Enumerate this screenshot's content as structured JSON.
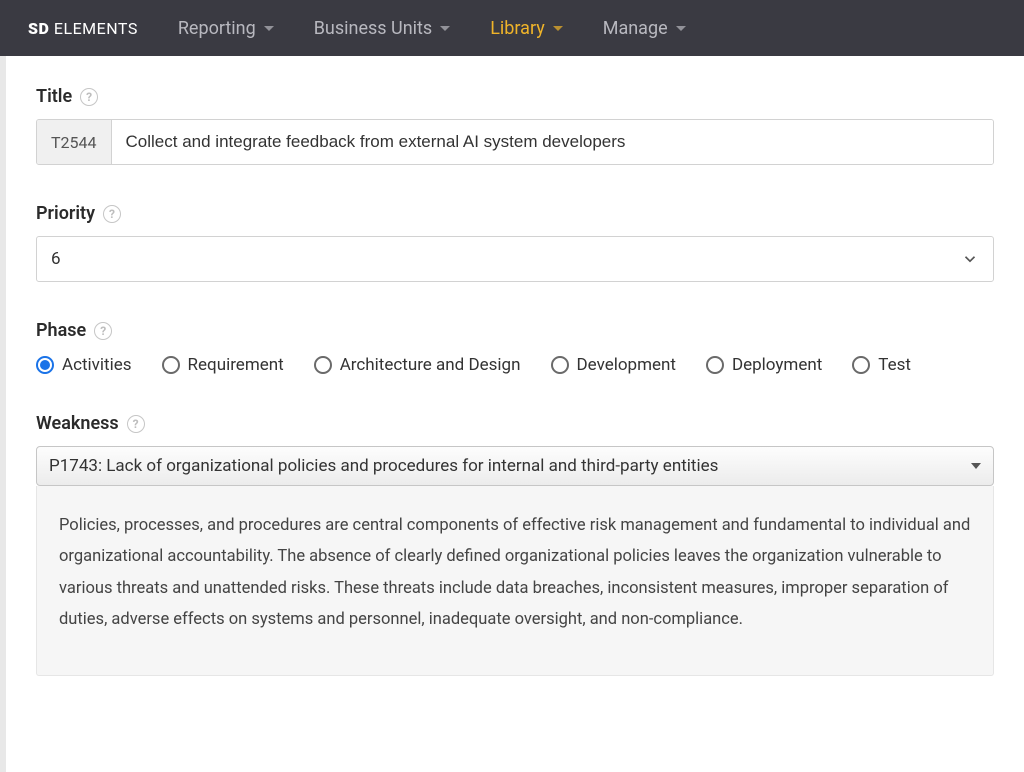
{
  "brand": {
    "left": "SD",
    "right": "ELEMENTS"
  },
  "nav": {
    "items": [
      {
        "label": "Reporting",
        "active": false
      },
      {
        "label": "Business Units",
        "active": false
      },
      {
        "label": "Library",
        "active": true
      },
      {
        "label": "Manage",
        "active": false
      }
    ]
  },
  "form": {
    "title": {
      "label": "Title",
      "id": "T2544",
      "value": "Collect and integrate feedback from external AI system developers"
    },
    "priority": {
      "label": "Priority",
      "value": "6"
    },
    "phase": {
      "label": "Phase",
      "selected": "Activities",
      "options": [
        "Activities",
        "Requirement",
        "Architecture and Design",
        "Development",
        "Deployment",
        "Test"
      ]
    },
    "weakness": {
      "label": "Weakness",
      "value": "P1743: Lack of organizational policies and procedures for internal and third-party entities",
      "description": "Policies, processes, and procedures are central components of effective risk management and fundamental to individual and organizational accountability. The absence of clearly defined organizational policies leaves the organization vulnerable to various threats and unattended risks. These threats include data breaches, inconsistent measures, improper separation of duties, adverse effects on systems and personnel, inadequate oversight, and non-compliance."
    }
  }
}
